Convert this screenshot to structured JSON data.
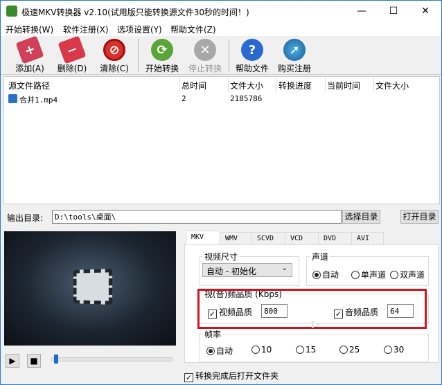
{
  "window": {
    "title": "极速MKV转换器 v2.10(试用版只能转换源文件30秒的时间！)",
    "minimize": "—",
    "maximize": "☐",
    "close": "✕"
  },
  "menu": [
    "开始转换(W)",
    "软件注册(X)",
    "选项设置(Y)",
    "帮助文件(Z)"
  ],
  "toolbar": {
    "add": "添加(A)",
    "delete": "删除(D)",
    "clear": "清除(C)",
    "start": "开始转换",
    "stop": "停止转换",
    "help": "帮助文件",
    "buy": "购买注册"
  },
  "table": {
    "headers": [
      "源文件路径",
      "总时间",
      "文件大小",
      "转换进度",
      "当前时间",
      "文件大小"
    ],
    "rows": [
      {
        "path": "合并1.mp4",
        "duration": "2",
        "size": "2185786"
      }
    ]
  },
  "output": {
    "label": "输出目录:",
    "value": "D:\\tools\\桌面\\",
    "choose": "选择目录",
    "open": "打开目录"
  },
  "player": {
    "progress": 0.02
  },
  "tabs": [
    "MKV",
    "WMV",
    "SCVD",
    "VCD",
    "DVD",
    "AVI"
  ],
  "video_size": {
    "label": "视频尺寸",
    "value": "自动 - 初始化"
  },
  "channel": {
    "label": "声道",
    "options": [
      "自动",
      "单声道",
      "双声道"
    ],
    "selected": 0
  },
  "quality": {
    "label": "视(音)频品质 (Kbps)",
    "video_label": "视频品质",
    "video_value": "800",
    "video_checked": true,
    "audio_label": "音频品质",
    "audio_value": "64",
    "audio_checked": true
  },
  "framerate": {
    "label": "帧率",
    "options": [
      "自动",
      "10",
      "15",
      "25",
      "30"
    ],
    "selected": 0
  },
  "open_after": {
    "label": "转换完成后打开文件夹",
    "checked": true
  },
  "colors": {
    "highlight": "#d0141c"
  }
}
